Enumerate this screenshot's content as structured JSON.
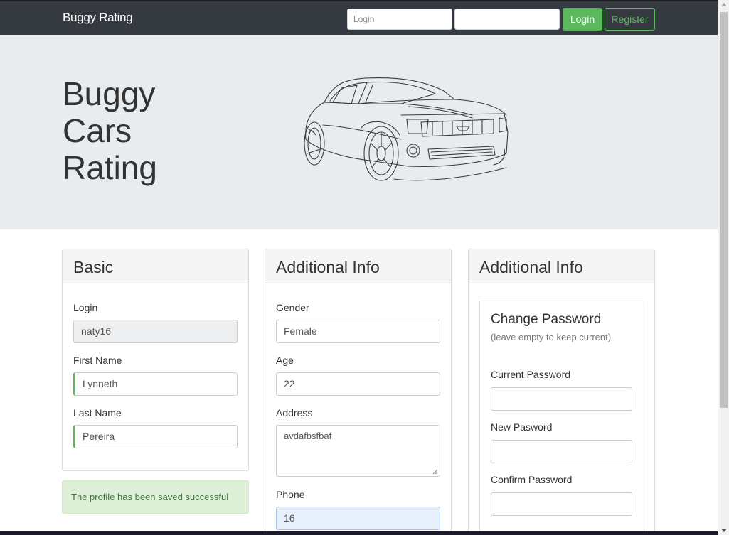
{
  "navbar": {
    "brand": "Buggy Rating",
    "login_placeholder": "Login",
    "password_value": "",
    "login_button": "Login",
    "register_button": "Register",
    "accent_color": "#5cb85c"
  },
  "hero": {
    "title_line1": "Buggy",
    "title_line2": "Cars",
    "title_line3": "Rating",
    "image": "sports-car-sketch"
  },
  "basic": {
    "title": "Basic",
    "login_label": "Login",
    "login_value": "naty16",
    "first_name_label": "First Name",
    "first_name_value": "Lynneth",
    "last_name_label": "Last Name",
    "last_name_value": "Pereira"
  },
  "alert": {
    "message": "The profile has been saved successful"
  },
  "additional": {
    "title": "Additional Info",
    "gender_label": "Gender",
    "gender_value": "Female",
    "age_label": "Age",
    "age_value": "22",
    "address_label": "Address",
    "address_value": "avdafbsfbaf",
    "phone_label": "Phone",
    "phone_value": "16"
  },
  "password": {
    "panel_title": "Additional Info",
    "title": "Change Password",
    "subtitle": "(leave empty to keep current)",
    "current_label": "Current Password",
    "new_label": "New Pasword",
    "confirm_label": "Confirm Password"
  }
}
